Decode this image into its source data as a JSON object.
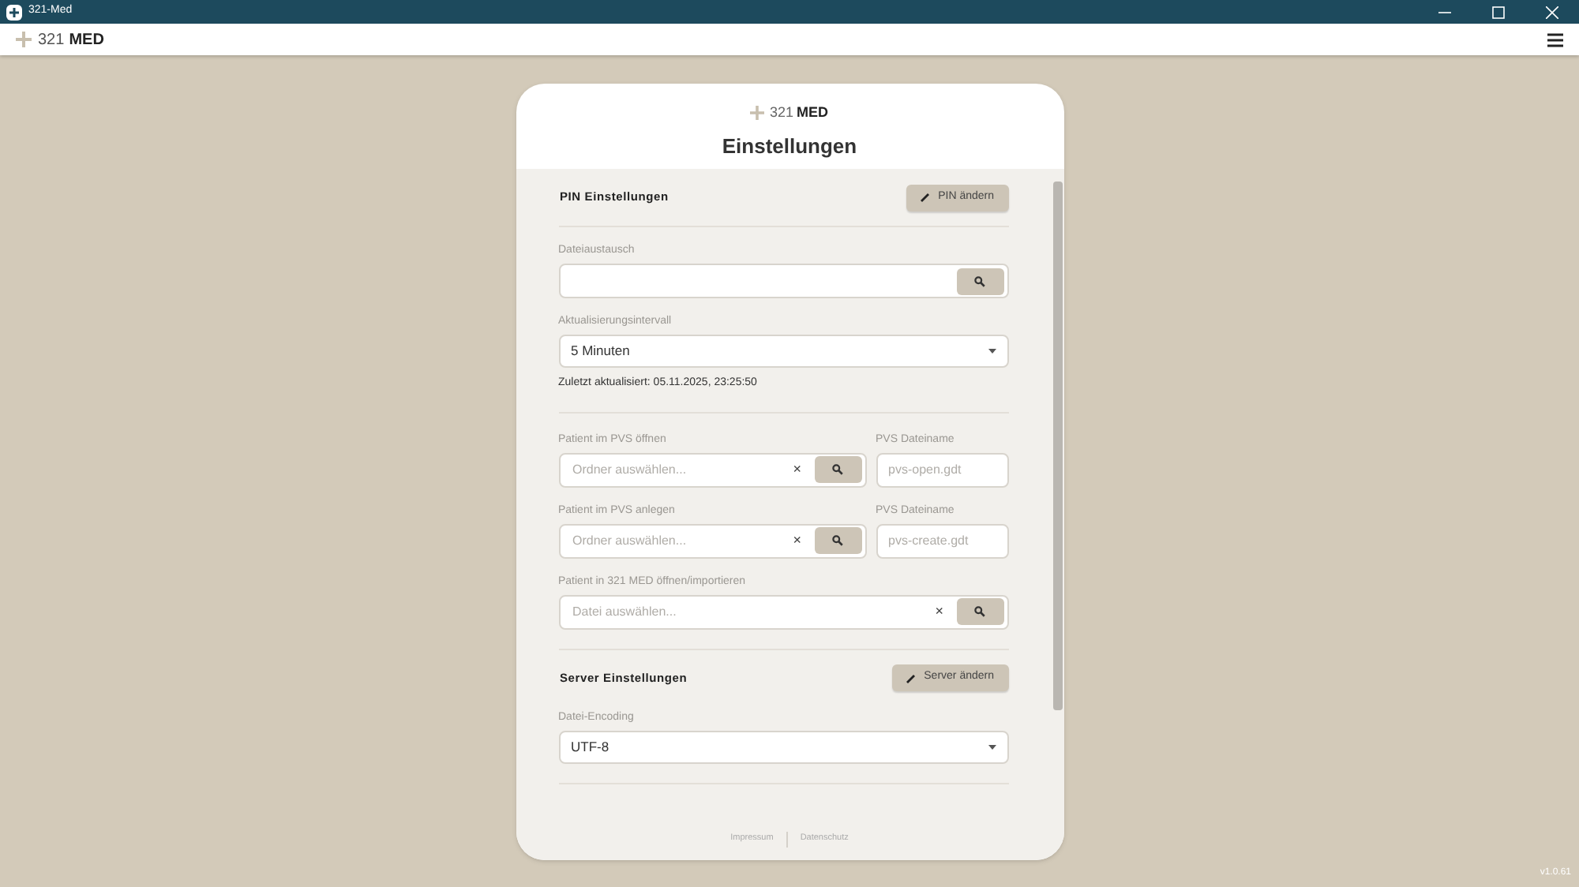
{
  "window": {
    "title": "321-Med"
  },
  "app_bar": {
    "logo_prefix": "321",
    "logo_suffix": "MED"
  },
  "card": {
    "logo_prefix": "321",
    "logo_suffix": "MED",
    "title": "Einstellungen"
  },
  "sections": [
    {
      "title": "PIN Einstellungen",
      "button": "PIN ändern",
      "rows": [
        [
          {
            "kind": "file",
            "label": "Dateiaustausch"
          }
        ],
        [
          {
            "kind": "select",
            "label": "Aktualisierungsintervall",
            "value": "5 Minuten"
          }
        ],
        [
          {
            "kind": "note",
            "text": "Zuletzt aktualisiert: 05.11.2025, 23:25:50"
          }
        ]
      ]
    },
    {
      "rows": [
        [
          {
            "kind": "file",
            "label": "Patient im PVS öffnen",
            "placeholder": "Ordner auswählen...",
            "clear": "×"
          },
          {
            "kind": "text",
            "label": "PVS Dateiname",
            "placeholder": "pvs-open.gdt"
          }
        ],
        [
          {
            "kind": "file",
            "label": "Patient im PVS anlegen",
            "placeholder": "Ordner auswählen...",
            "clear": "×"
          },
          {
            "kind": "text",
            "label": "PVS Dateiname",
            "placeholder": "pvs-create.gdt"
          }
        ],
        [
          {
            "kind": "file",
            "label": "Patient in 321 MED öffnen/importieren",
            "placeholder": "Datei auswählen...",
            "clear": "×"
          }
        ]
      ]
    },
    {
      "title": "Server Einstellungen",
      "button": "Server ändern",
      "rows": [
        [
          {
            "kind": "select",
            "label": "Datei-Encoding",
            "value": "UTF-8"
          }
        ]
      ]
    }
  ],
  "footer_links": [
    "Impressum",
    "Datenschutz"
  ],
  "version": "v1.0.61"
}
